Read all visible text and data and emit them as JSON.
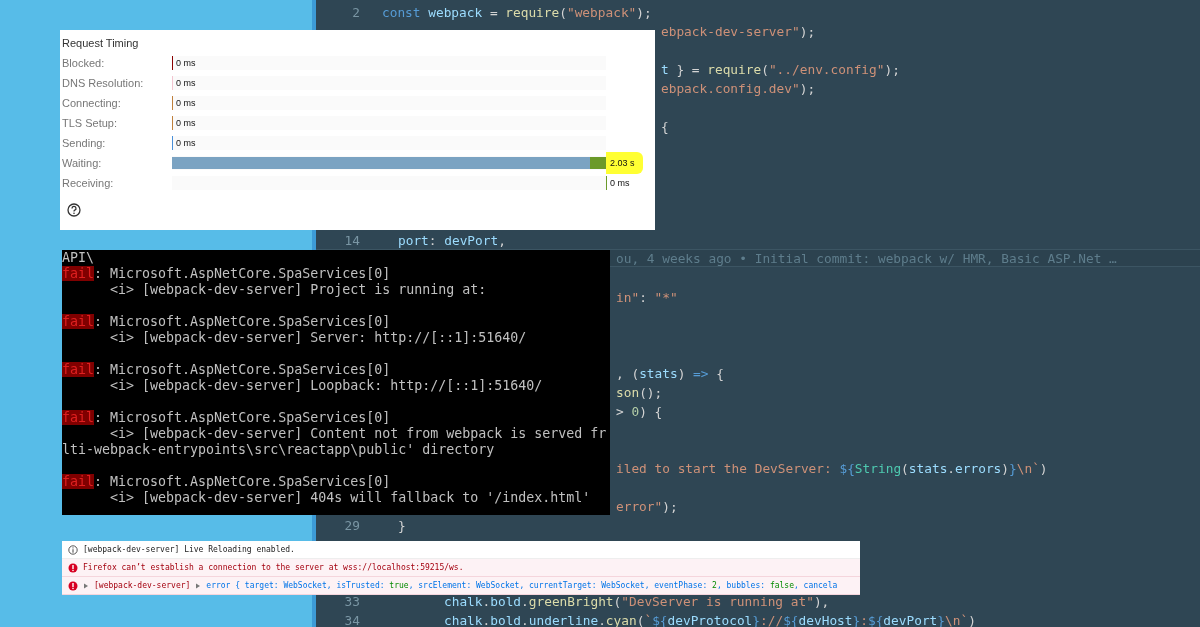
{
  "editor": {
    "lines": [
      {
        "number": "2",
        "tokens": [
          {
            "text": "const ",
            "kind": "keyword"
          },
          {
            "text": "webpack",
            "kind": "variable"
          },
          {
            "text": " = ",
            "kind": "plain"
          },
          {
            "text": "require",
            "kind": "function"
          },
          {
            "text": "(",
            "kind": "plain"
          },
          {
            "text": "\"webpack\"",
            "kind": "string"
          },
          {
            "text": ");",
            "kind": "plain"
          }
        ]
      },
      {
        "tokens": [
          {
            "text": "ebpack-dev-server\"",
            "kind": "string"
          },
          {
            "text": ");",
            "kind": "plain"
          }
        ]
      },
      {
        "tokens": [
          {
            "text": "t",
            "kind": "variable"
          },
          {
            "text": " } = ",
            "kind": "plain"
          },
          {
            "text": "require",
            "kind": "function"
          },
          {
            "text": "(",
            "kind": "plain"
          },
          {
            "text": "\"../env.config\"",
            "kind": "string"
          },
          {
            "text": ");",
            "kind": "plain"
          }
        ]
      },
      {
        "tokens": [
          {
            "text": "ebpack.config.dev\"",
            "kind": "string"
          },
          {
            "text": ");",
            "kind": "plain"
          }
        ]
      },
      {
        "tokens": [
          {
            "text": "{",
            "kind": "plain"
          }
        ]
      },
      {
        "number": "14",
        "tokens": [
          {
            "text": "port",
            "kind": "variable"
          },
          {
            "text": ": ",
            "kind": "plain"
          },
          {
            "text": "devPort",
            "kind": "variable"
          },
          {
            "text": ",",
            "kind": "plain"
          }
        ]
      },
      {
        "kind": "blame",
        "text": "ou, 4 weeks ago • Initial commit: webpack w/ HMR, Basic ASP.Net …"
      },
      {
        "tokens": [
          {
            "text": "in\"",
            "kind": "string"
          },
          {
            "text": ": ",
            "kind": "plain"
          },
          {
            "text": "\"*\"",
            "kind": "string"
          }
        ]
      },
      {
        "tokens": [
          {
            "text": ", (",
            "kind": "plain"
          },
          {
            "text": "stats",
            "kind": "variable"
          },
          {
            "text": ") ",
            "kind": "plain"
          },
          {
            "text": "=>",
            "kind": "keyword"
          },
          {
            "text": " {",
            "kind": "plain"
          }
        ]
      },
      {
        "tokens": [
          {
            "text": "son",
            "kind": "function"
          },
          {
            "text": "();",
            "kind": "plain"
          }
        ]
      },
      {
        "tokens": [
          {
            "text": "> ",
            "kind": "plain"
          },
          {
            "text": "0",
            "kind": "number"
          },
          {
            "text": ") {",
            "kind": "plain"
          }
        ]
      },
      {
        "tokens": [
          {
            "text": "iled to start the DevServer: ",
            "kind": "string"
          },
          {
            "text": "${",
            "kind": "keyword"
          },
          {
            "text": "String",
            "kind": "type"
          },
          {
            "text": "(",
            "kind": "plain"
          },
          {
            "text": "stats",
            "kind": "variable"
          },
          {
            "text": ".",
            "kind": "plain"
          },
          {
            "text": "errors",
            "kind": "variable"
          },
          {
            "text": ")",
            "kind": "plain"
          },
          {
            "text": "}",
            "kind": "keyword"
          },
          {
            "text": "\\n`",
            "kind": "string"
          },
          {
            "text": ")",
            "kind": "plain"
          }
        ]
      },
      {
        "tokens": [
          {
            "text": "error\"",
            "kind": "string"
          },
          {
            "text": ");",
            "kind": "plain"
          }
        ]
      },
      {
        "number": "29",
        "tokens": [
          {
            "text": "}",
            "kind": "plain"
          }
        ]
      },
      {
        "number": "33",
        "tokens": [
          {
            "text": "chalk",
            "kind": "variable"
          },
          {
            "text": ".",
            "kind": "plain"
          },
          {
            "text": "bold",
            "kind": "variable"
          },
          {
            "text": ".",
            "kind": "plain"
          },
          {
            "text": "greenBright",
            "kind": "function"
          },
          {
            "text": "(",
            "kind": "plain"
          },
          {
            "text": "\"DevServer is running at\"",
            "kind": "string"
          },
          {
            "text": "),",
            "kind": "plain"
          }
        ]
      },
      {
        "number": "34",
        "tokens": [
          {
            "text": "chalk",
            "kind": "variable"
          },
          {
            "text": ".",
            "kind": "plain"
          },
          {
            "text": "bold",
            "kind": "variable"
          },
          {
            "text": ".",
            "kind": "plain"
          },
          {
            "text": "underline",
            "kind": "variable"
          },
          {
            "text": ".",
            "kind": "plain"
          },
          {
            "text": "cyan",
            "kind": "function"
          },
          {
            "text": "(",
            "kind": "plain"
          },
          {
            "text": "`",
            "kind": "string"
          },
          {
            "text": "${",
            "kind": "keyword"
          },
          {
            "text": "devProtocol",
            "kind": "variable"
          },
          {
            "text": "}",
            "kind": "keyword"
          },
          {
            "text": "://",
            "kind": "string"
          },
          {
            "text": "${",
            "kind": "keyword"
          },
          {
            "text": "devHost",
            "kind": "variable"
          },
          {
            "text": "}",
            "kind": "keyword"
          },
          {
            "text": ":",
            "kind": "string"
          },
          {
            "text": "${",
            "kind": "keyword"
          },
          {
            "text": "devPort",
            "kind": "variable"
          },
          {
            "text": "}",
            "kind": "keyword"
          },
          {
            "text": "\\n`",
            "kind": "string"
          },
          {
            "text": ")",
            "kind": "plain"
          }
        ]
      }
    ]
  },
  "request_timing": {
    "title": "Request Timing",
    "rows": [
      {
        "label": "Blocked:",
        "value": "0 ms",
        "level": 0,
        "color": "#8b0000",
        "highlighted": false
      },
      {
        "label": "DNS Resolution:",
        "value": "0 ms",
        "level": 0,
        "color": "#f2c4cf",
        "highlighted": false
      },
      {
        "label": "Connecting:",
        "value": "0 ms",
        "level": 0,
        "color": "#c0803c",
        "highlighted": false
      },
      {
        "label": "TLS Setup:",
        "value": "0 ms",
        "level": 0,
        "color": "#c0803c",
        "highlighted": false
      },
      {
        "label": "Sending:",
        "value": "0 ms",
        "level": 0,
        "color": "#4a90d9",
        "highlighted": false
      },
      {
        "label": "Waiting:",
        "value": "2.03 s",
        "level": 1,
        "color": "#7ba3c2",
        "highlighted": true
      },
      {
        "label": "Receiving:",
        "value": "0 ms",
        "level": 0,
        "color": "#6b9a2a",
        "highlighted": false
      }
    ]
  },
  "terminal": {
    "lines": [
      {
        "kind": "text",
        "text": "API\\"
      },
      {
        "kind": "fail",
        "tag": "fail",
        "text": ": Microsoft.AspNetCore.SpaServices[0]"
      },
      {
        "kind": "text",
        "text": "      <i> [webpack-dev-server] Project is running at:"
      },
      {
        "kind": "blank"
      },
      {
        "kind": "fail",
        "tag": "fail",
        "text": ": Microsoft.AspNetCore.SpaServices[0]"
      },
      {
        "kind": "text",
        "text": "      <i> [webpack-dev-server] Server: http://[::1]:51640/"
      },
      {
        "kind": "blank"
      },
      {
        "kind": "fail",
        "tag": "fail",
        "text": ": Microsoft.AspNetCore.SpaServices[0]"
      },
      {
        "kind": "text",
        "text": "      <i> [webpack-dev-server] Loopback: http://[::1]:51640/"
      },
      {
        "kind": "blank"
      },
      {
        "kind": "fail",
        "tag": "fail",
        "text": ": Microsoft.AspNetCore.SpaServices[0]"
      },
      {
        "kind": "text",
        "text": "      <i> [webpack-dev-server] Content not from webpack is served fr"
      },
      {
        "kind": "text",
        "text": "lti-webpack-entrypoints\\src\\reactapp\\public' directory"
      },
      {
        "kind": "blank"
      },
      {
        "kind": "fail",
        "tag": "fail",
        "text": ": Microsoft.AspNetCore.SpaServices[0]"
      },
      {
        "kind": "text",
        "text": "      <i> [webpack-dev-server] 404s will fallback to '/index.html'"
      }
    ]
  },
  "console": {
    "messages": [
      {
        "kind": "info",
        "text": "[webpack-dev-server] Live Reloading enabled."
      },
      {
        "kind": "error",
        "text": "Firefox can’t establish a connection to the server at wss://localhost:59215/ws."
      },
      {
        "kind": "error",
        "source": "[webpack-dev-server]",
        "tokens": [
          {
            "text": "error { ",
            "kind": "key"
          },
          {
            "text": "target: WebSocket, ",
            "kind": "key"
          },
          {
            "text": "isTrusted: ",
            "kind": "key"
          },
          {
            "text": "true",
            "kind": "value"
          },
          {
            "text": ", srcElement: WebSocket, currentTarget: WebSocket, eventPhase: ",
            "kind": "key"
          },
          {
            "text": "2",
            "kind": "value"
          },
          {
            "text": ", bubbles: ",
            "kind": "key"
          },
          {
            "text": "false",
            "kind": "value"
          },
          {
            "text": ", cancela",
            "kind": "key"
          }
        ]
      }
    ]
  }
}
